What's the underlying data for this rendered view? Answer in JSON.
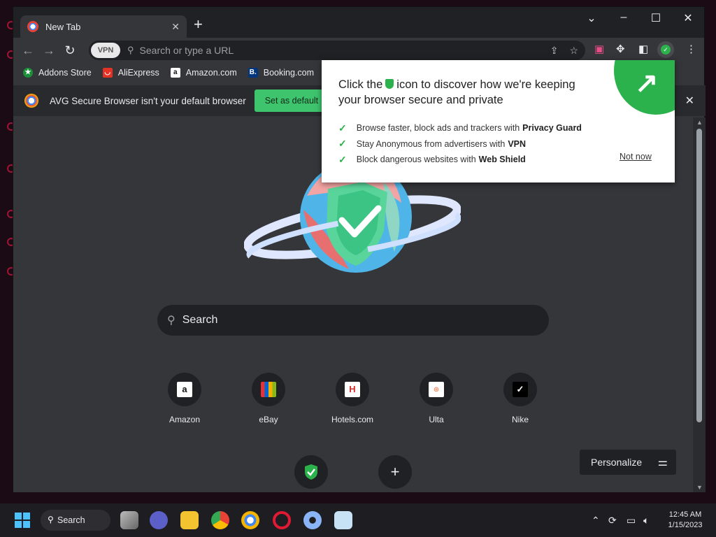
{
  "browser": {
    "tab_title": "New Tab",
    "omnibox_placeholder": "Search or type a URL",
    "vpn_label": "VPN"
  },
  "bookmarks": [
    {
      "label": "Addons Store"
    },
    {
      "label": "AliExpress"
    },
    {
      "label": "Amazon.com"
    },
    {
      "label": "Booking.com"
    }
  ],
  "infobar": {
    "message": "AVG Secure Browser isn't your default browser",
    "button_label": "Set as default"
  },
  "popup": {
    "title_before_icon": "Click the",
    "title_after_icon": "icon to discover how we're keeping your browser secure and private",
    "items": [
      {
        "text": "Browse faster, block ads and trackers with",
        "bold": "Privacy Guard"
      },
      {
        "text": "Stay Anonymous from advertisers with",
        "bold": "VPN"
      },
      {
        "text": "Block dangerous websites with",
        "bold": "Web Shield"
      }
    ],
    "not_now": "Not now"
  },
  "newtab": {
    "search_label": "Search",
    "tiles": [
      {
        "name": "Amazon"
      },
      {
        "name": "eBay"
      },
      {
        "name": "Hotels.com"
      },
      {
        "name": "Ulta"
      },
      {
        "name": "Nike"
      }
    ],
    "personalize_label": "Personalize"
  },
  "taskbar": {
    "search_label": "Search",
    "time": "12:45 AM",
    "date": "1/15/2023"
  },
  "colors": {
    "accent_green": "#2bb24c",
    "set_default_green": "#3ec46d",
    "chrome_dark": "#35363a"
  }
}
